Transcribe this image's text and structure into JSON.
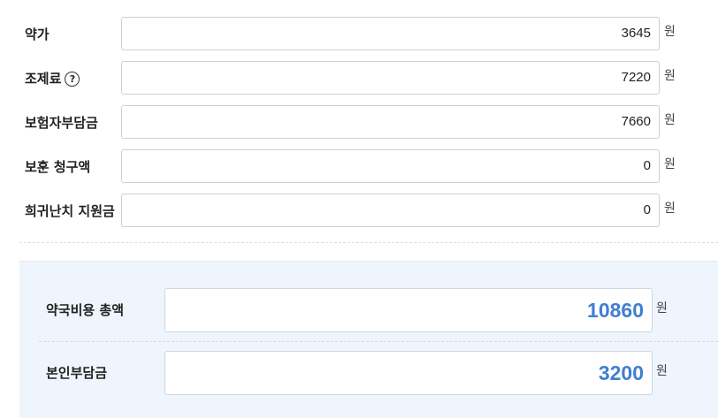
{
  "rows": [
    {
      "label": "약가",
      "value": "3645",
      "unit": "원"
    },
    {
      "label": "조제료",
      "value": "7220",
      "unit": "원",
      "help_icon": "?"
    },
    {
      "label": "보험자부담금",
      "value": "7660",
      "unit": "원"
    },
    {
      "label": "보훈 청구액",
      "value": "0",
      "unit": "원"
    },
    {
      "label": "희귀난치 지원금",
      "value": "0",
      "unit": "원"
    }
  ],
  "summary": {
    "total": {
      "label": "약국비용 총액",
      "value": "10860",
      "unit": "원"
    },
    "copay": {
      "label": "본인부담금",
      "value": "3200",
      "unit": "원"
    }
  },
  "colors": {
    "summary_background": "#eef5fc",
    "summary_value": "#3f7fd0"
  },
  "icons": {
    "help": "question-circle-icon"
  }
}
